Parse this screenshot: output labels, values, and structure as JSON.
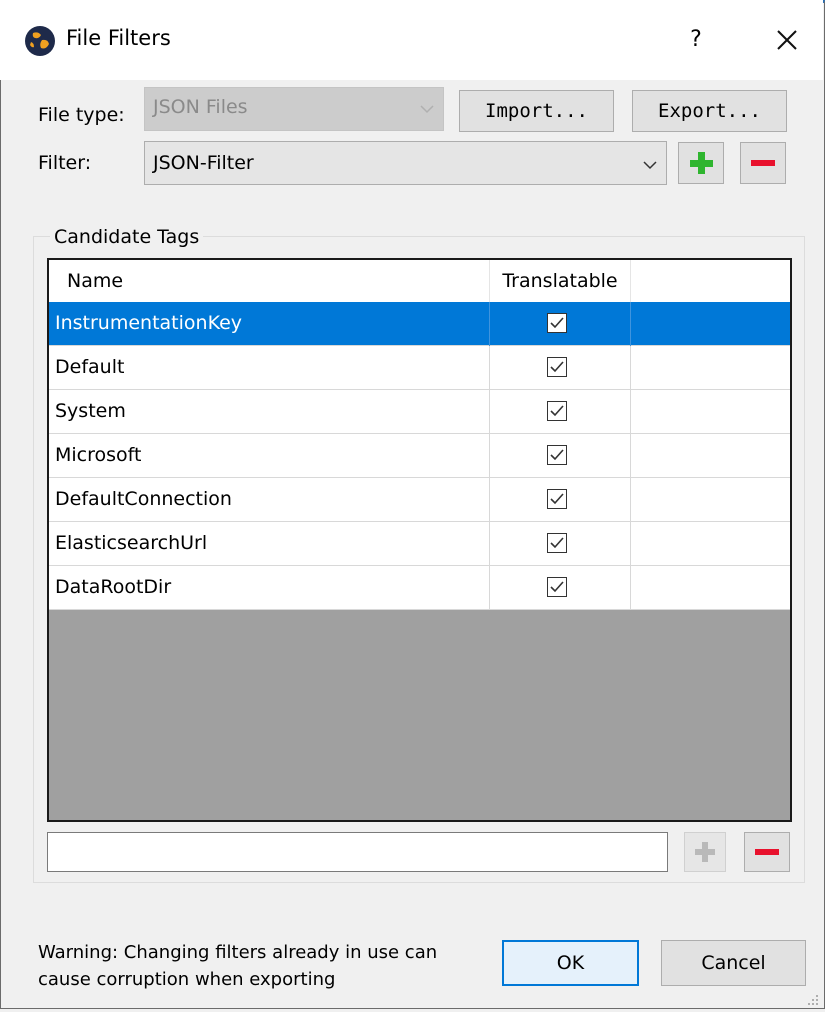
{
  "window": {
    "title": "File Filters",
    "help_label": "?",
    "close_label": "✕"
  },
  "form": {
    "file_type_label": "File type:",
    "file_type_value": "JSON Files",
    "filter_label": "Filter:",
    "filter_value": "JSON-Filter",
    "import_label": "Import...",
    "export_label": "Export..."
  },
  "candidate_tags": {
    "group_title": "Candidate Tags",
    "columns": [
      "Name",
      "Translatable"
    ],
    "rows": [
      {
        "name": "InstrumentationKey",
        "translatable": true,
        "selected": true
      },
      {
        "name": "Default",
        "translatable": true,
        "selected": false
      },
      {
        "name": "System",
        "translatable": true,
        "selected": false
      },
      {
        "name": "Microsoft",
        "translatable": true,
        "selected": false
      },
      {
        "name": "DefaultConnection",
        "translatable": true,
        "selected": false
      },
      {
        "name": "ElasticsearchUrl",
        "translatable": true,
        "selected": false
      },
      {
        "name": "DataRootDir",
        "translatable": true,
        "selected": false
      }
    ],
    "new_tag_value": ""
  },
  "footer": {
    "warning": "Warning: Changing filters already in use can cause corruption when exporting",
    "ok_label": "OK",
    "cancel_label": "Cancel"
  },
  "colors": {
    "selection": "#0078d7",
    "add_icon": "#2fb52f",
    "remove_icon": "#e8112d",
    "add_icon_disabled": "#b9b9b9"
  },
  "icons": {
    "app": "globe-icon",
    "add": "plus-icon",
    "remove": "minus-icon",
    "dropdown": "chevron-down-icon",
    "checkbox": "checkmark-icon"
  }
}
